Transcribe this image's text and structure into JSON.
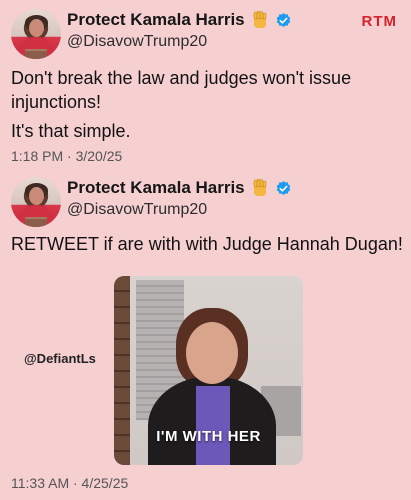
{
  "watermark": "RTM",
  "overlay_tag": "@DefiantLs",
  "tweets": [
    {
      "display_name": "Protect Kamala Harris",
      "handle": "@DisavowTrump20",
      "text_lines": [
        "Don't break the law and judges won't issue injunctions!",
        "It's that simple."
      ],
      "timestamp": "1:18 PM · 3/20/25",
      "icons": [
        "raised-fist-emoji",
        "verified-badge"
      ]
    },
    {
      "display_name": "Protect Kamala Harris",
      "handle": "@DisavowTrump20",
      "text_lines": [
        "RETWEET if are with with Judge Hannah Dugan!"
      ],
      "timestamp": "11:33 AM · 4/25/25",
      "media_caption": "I'M WITH HER",
      "icons": [
        "raised-fist-emoji",
        "verified-badge"
      ]
    }
  ],
  "colors": {
    "background": "#f6cfd0",
    "verified": "#1d9bf0",
    "watermark": "#d6222c",
    "fist": "#f4b63f"
  }
}
